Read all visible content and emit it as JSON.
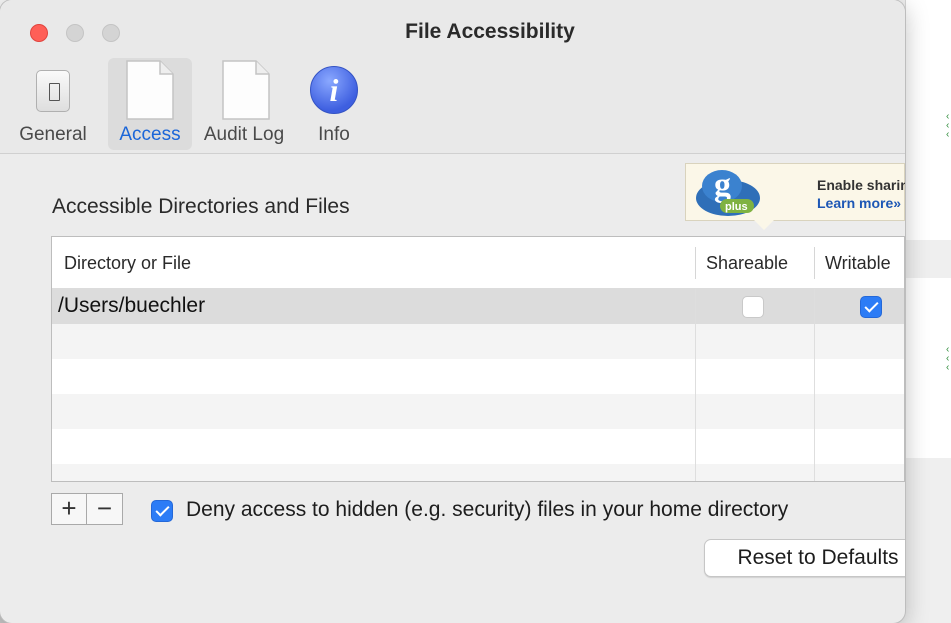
{
  "window": {
    "title": "File Accessibility"
  },
  "toolbar": {
    "tabs": [
      {
        "label": "General",
        "icon": "switch-icon"
      },
      {
        "label": "Access",
        "icon": "document-icon",
        "selected": true
      },
      {
        "label": "Audit Log",
        "icon": "document-icon"
      },
      {
        "label": "Info",
        "icon": "info-icon"
      }
    ]
  },
  "access": {
    "heading": "Accessible Directories and Files",
    "promo": {
      "logo_text": "plus",
      "line1": "Enable sharin",
      "line2": "Learn more»"
    },
    "table": {
      "columns": [
        "Directory or File",
        "Shareable",
        "Writable"
      ],
      "rows": [
        {
          "path": "/Users/buechler",
          "shareable": false,
          "writable": true
        }
      ]
    },
    "add_label": "+",
    "remove_label": "−",
    "deny_hidden": {
      "checked": true,
      "label": "Deny access to hidden (e.g. security) files in your home directory"
    },
    "reset_label": "Reset to Defaults"
  },
  "colors": {
    "accent": "#2c7cf6",
    "selected_tab_text": "#1b66d8",
    "close_button": "#ff5f57"
  }
}
